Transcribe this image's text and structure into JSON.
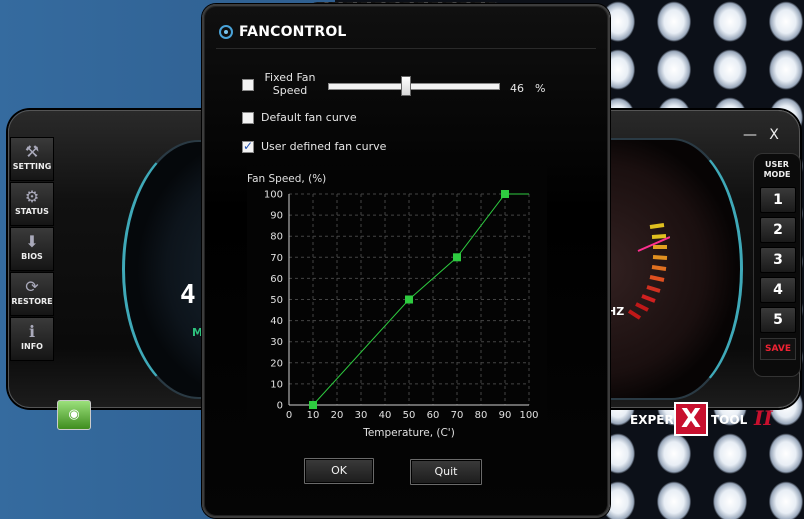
{
  "tool_nav": [
    {
      "label": "SETTING",
      "icon": "wrench-icon"
    },
    {
      "label": "STATUS",
      "icon": "gear-icon"
    },
    {
      "label": "BIOS",
      "icon": "download-arrow-icon"
    },
    {
      "label": "RESTORE",
      "icon": "refresh-icon"
    },
    {
      "label": "INFO",
      "icon": "info-icon"
    }
  ],
  "tool": {
    "left_gauge_value": "4",
    "left_gauge_unit": "M",
    "right_gauge_unit": "HZ",
    "right_gauge_sub": "t",
    "minimize": "—",
    "close": "X",
    "user_mode_title": "USER MODE",
    "modes": [
      "1",
      "2",
      "3",
      "4",
      "5"
    ],
    "save": "SAVE",
    "logo_left": "EXPER",
    "logo_x": "X",
    "logo_right": "TOOL",
    "logo_suffix": "II"
  },
  "dialog": {
    "title": "FANCONTROL",
    "fixed_label": "Fixed Fan Speed",
    "fixed_checked": false,
    "fixed_value": "46",
    "fixed_unit": "%",
    "fixed_fraction": 0.46,
    "default_label": "Default fan curve",
    "default_checked": false,
    "user_label": "User defined fan curve",
    "user_checked": true,
    "ok": "OK",
    "quit": "Quit"
  },
  "chart_data": {
    "type": "line",
    "ylabel": "Fan Speed, (%)",
    "xlabel": "Temperature, (C')",
    "x_ticks": [
      0,
      10,
      20,
      30,
      40,
      50,
      60,
      70,
      80,
      90,
      100
    ],
    "y_ticks": [
      0,
      10,
      20,
      30,
      40,
      50,
      60,
      70,
      80,
      90,
      100
    ],
    "xlim": [
      0,
      100
    ],
    "ylim": [
      0,
      100
    ],
    "grid": true,
    "series": [
      {
        "x": [
          10,
          50,
          70,
          90,
          100
        ],
        "y": [
          0,
          50,
          70,
          100,
          100
        ],
        "markers": [
          true,
          true,
          true,
          true,
          false
        ]
      }
    ],
    "colors": {
      "line": "#2ecc40",
      "marker": "#2ecc40",
      "grid": "#444444",
      "axis": "#cfcfcf"
    }
  }
}
